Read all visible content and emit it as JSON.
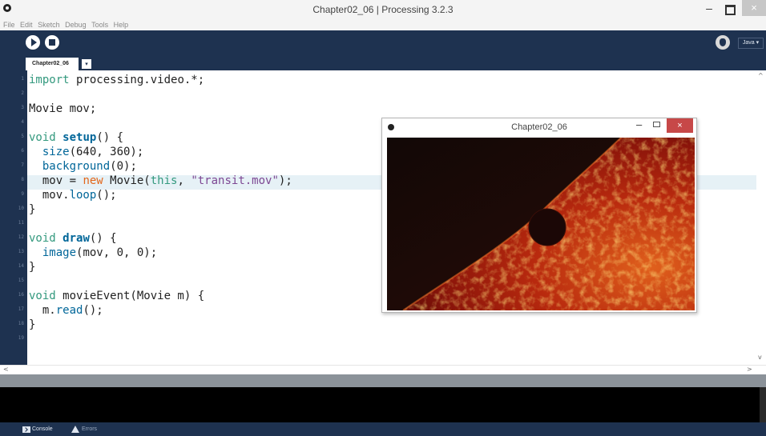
{
  "window": {
    "title": "Chapter02_06 | Processing 3.2.3",
    "minimize": "–",
    "close": "×"
  },
  "menu": [
    "File",
    "Edit",
    "Sketch",
    "Debug",
    "Tools",
    "Help"
  ],
  "toolbar": {
    "run_icon": "play-icon",
    "stop_icon": "stop-icon",
    "debug_icon": "bug-icon",
    "mode": "Java ▾"
  },
  "tabs": {
    "active": "Chapter02_06",
    "menu": "▾"
  },
  "editor": {
    "line_numbers": [
      "1",
      "2",
      "3",
      "4",
      "5",
      "6",
      "7",
      "8",
      "9",
      "10",
      "11",
      "12",
      "13",
      "14",
      "15",
      "16",
      "17",
      "18",
      "19"
    ],
    "highlighted_line": 8
  },
  "sketch_window": {
    "title": "Chapter02_06",
    "minimize": "–",
    "close": "×"
  },
  "bottom": {
    "console_label": "Console",
    "errors_label": "Errors"
  },
  "scroll": {
    "up": "^",
    "down": "v",
    "left": "<",
    "right": ">"
  },
  "colors": {
    "chrome": "#1e3250",
    "keyword": "#33997e",
    "function": "#006699",
    "string": "#7d4793",
    "constant": "#e2661a"
  }
}
